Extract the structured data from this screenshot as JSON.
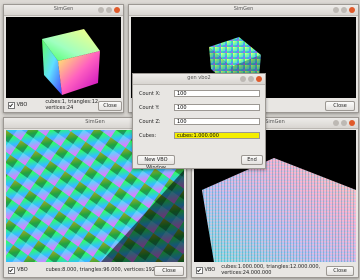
{
  "windows": {
    "top_left": {
      "title": "SimGen",
      "vbo_label": "VBO",
      "stats": "cubes:1, triangles:12, vertices:24",
      "close_label": "Close"
    },
    "top_right": {
      "title": "SimGen",
      "close_label": "Close"
    },
    "bottom_left": {
      "title": "SimGen",
      "vbo_label": "VBO",
      "stats": "cubes:8.000, triangles:96.000, vertices:192.000",
      "close_label": "Close"
    },
    "bottom_right": {
      "title": "SimGen",
      "vbo_label": "VBO",
      "stats": "cubes:1.000.000, triangles:12.000.000, vertices:24.000.000",
      "close_label": "Close"
    }
  },
  "dialog": {
    "title": "gen vbo2",
    "count_x_label": "Count X:",
    "count_x_value": "100",
    "count_y_label": "Count Y:",
    "count_y_value": "100",
    "count_z_label": "Count Z:",
    "count_z_value": "100",
    "cubes_label": "Cubes:",
    "cubes_value": "cubes:1.000.000",
    "new_window_label": "New VBO Window",
    "end_label": "End"
  },
  "colors": {
    "highlight": "#f4ee00",
    "close": "#e05a2a",
    "canvas": "#000000"
  }
}
